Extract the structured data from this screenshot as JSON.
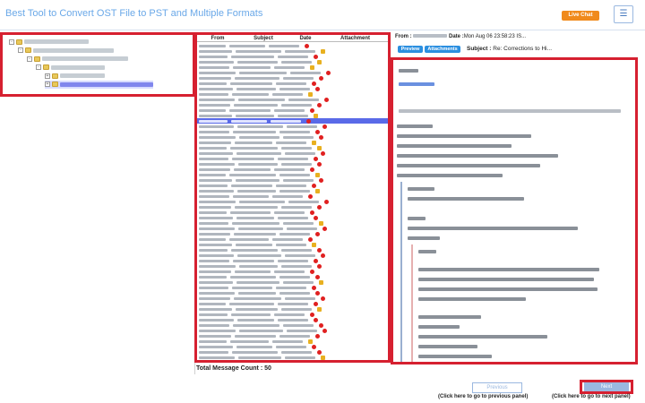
{
  "app": {
    "title": "Best Tool to Convert OST File to PST and Multiple Formats",
    "live_chat_label": "Live Chat",
    "menu_icon": "hamburger-icon"
  },
  "tree": {
    "items": [
      {
        "level": 0,
        "toggle": "-",
        "label_width": 72
      },
      {
        "level": 1,
        "toggle": "-",
        "label_width": 90
      },
      {
        "level": 2,
        "toggle": "-",
        "label_width": 96
      },
      {
        "level": 3,
        "toggle": "-",
        "label_width": 60
      },
      {
        "level": 4,
        "toggle": "+",
        "label_width": 50
      },
      {
        "level": 4,
        "toggle": "+",
        "label_width": 104,
        "selected": true
      }
    ]
  },
  "list": {
    "headers": {
      "from": "From",
      "subject": "Subject",
      "date": "Date",
      "attachment": "Attachment"
    },
    "total_label": "Total Message Count : 50",
    "selected_index": 14,
    "row_count": 61
  },
  "preview": {
    "from_label": "From :",
    "date_label": "Date :",
    "date_value": "Mon Aug 06 23:58:23 IS...",
    "preview_tab": "Preview",
    "attachments_tab": "Attachments",
    "subject_label": "Subject :",
    "subject_value": "Re: Corrections to Hi..."
  },
  "nav": {
    "previous_label": "Previous",
    "next_label": "Next",
    "previous_hint": "(Click here to go to previous panel)",
    "next_hint": "(Click here to go to next panel)"
  }
}
